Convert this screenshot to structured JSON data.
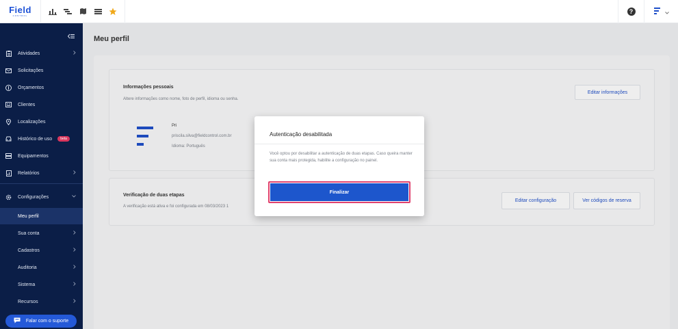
{
  "app": {
    "logo": "Field",
    "logo_sub": "CONTROL"
  },
  "topbar": {
    "icons": [
      "bar-chart-icon",
      "gantt-icon",
      "map-icon",
      "list-icon",
      "star-icon"
    ],
    "help": "?"
  },
  "sidebar": {
    "items": [
      {
        "label": "Atividades",
        "icon": "clipboard-icon",
        "chevron": true
      },
      {
        "label": "Solicitações",
        "icon": "mail-icon",
        "chevron": false
      },
      {
        "label": "Orçamentos",
        "icon": "dollar-icon",
        "chevron": false
      },
      {
        "label": "Clientes",
        "icon": "building-icon",
        "chevron": false
      },
      {
        "label": "Localizações",
        "icon": "pin-icon",
        "chevron": false
      },
      {
        "label": "Histórico de uso",
        "icon": "car-icon",
        "badge": "beta"
      },
      {
        "label": "Equipamentos",
        "icon": "server-icon",
        "chevron": false
      },
      {
        "label": "Relatórios",
        "icon": "report-icon",
        "chevron": true
      }
    ],
    "config": {
      "label": "Configurações",
      "icon": "gear-icon"
    },
    "sub_items": [
      {
        "label": "Meu perfil",
        "active": true,
        "chevron": false
      },
      {
        "label": "Sua conta",
        "chevron": true
      },
      {
        "label": "Cadastros",
        "chevron": true
      },
      {
        "label": "Auditoria",
        "chevron": true
      },
      {
        "label": "Sistema",
        "chevron": true
      },
      {
        "label": "Recursos",
        "chevron": true
      }
    ],
    "support": "Falar com o suporte"
  },
  "main": {
    "title": "Meu perfil",
    "personal": {
      "title": "Informações pessoais",
      "subtitle": "Altere informações como nome, foto de perfil, idioma ou senha.",
      "edit_button": "Editar informações",
      "name": "Pri",
      "email": "priscila.silva@fieldcontrol.com.br",
      "language": "Idioma: Português"
    },
    "two_step": {
      "title": "Verificação de duas etapas",
      "subtitle": "A verificação está ativa e foi configurada em 08/03/2023 1",
      "edit_button": "Editar configuração",
      "codes_button": "Ver códigos de reserva"
    }
  },
  "modal": {
    "title": "Autenticação desabilitada",
    "body": "Você optou por desabilitar a autenticação de duas etapas. Caso queira manter sua conta mais protegida, habilite a configuração no painel.",
    "button": "Finalizar"
  },
  "colors": {
    "brand": "#1d4ec9",
    "sidebar": "#0b1e47",
    "highlight": "#e0416d"
  }
}
